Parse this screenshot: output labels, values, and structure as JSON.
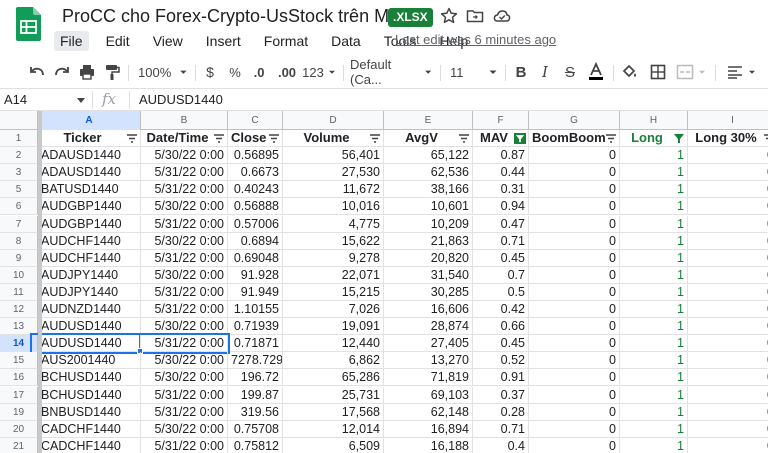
{
  "app": {
    "title": "ProCC cho Forex-Crypto-UsStock trên MT4",
    "badge": ".XLSX",
    "last_edit": "Last edit was 6 minutes ago",
    "brand_color": "#188038",
    "accent_color": "#1a73e8"
  },
  "menu": [
    "File",
    "Edit",
    "View",
    "Insert",
    "Format",
    "Data",
    "Tools",
    "Help"
  ],
  "toolbar": {
    "zoom": "100%",
    "currency": "$",
    "percent": "%",
    "dec_decrease": ".0",
    "dec_increase": ".00",
    "more_formats": "123",
    "font_family": "Default (Ca...",
    "font_size": "11",
    "icons": [
      "undo-icon",
      "redo-icon",
      "print-icon",
      "paint-format-icon",
      "bold-icon",
      "italic-icon",
      "strikethrough-icon",
      "text-color-icon",
      "fill-color-icon",
      "borders-icon",
      "merge-icon",
      "align-icon"
    ]
  },
  "formula_bar": {
    "cell_ref": "A14",
    "fx": "fx",
    "value": "AUDUSD1440"
  },
  "sheet": {
    "columns": [
      "A",
      "B",
      "C",
      "D",
      "E",
      "F",
      "G",
      "H",
      "I"
    ],
    "headers": [
      "Ticker",
      "Date/Time",
      "Close",
      "Volume",
      "AvgV",
      "MAV",
      "BoomBoom",
      "Long",
      "Long 30%"
    ],
    "selected_cell": "A14",
    "rows": [
      {
        "n": "1"
      },
      {
        "n": "2",
        "cells": [
          "ADAUSD1440",
          "5/30/22 0:00",
          "0.56895",
          "56,401",
          "65,122",
          "0.87",
          "0",
          "1",
          "0"
        ]
      },
      {
        "n": "3",
        "cells": [
          "ADAUSD1440",
          "5/31/22 0:00",
          "0.6673",
          "27,530",
          "62,536",
          "0.44",
          "0",
          "1",
          "0"
        ]
      },
      {
        "n": "5",
        "cells": [
          "BATUSD1440",
          "5/31/22 0:00",
          "0.40243",
          "11,672",
          "38,166",
          "0.31",
          "0",
          "1",
          "0"
        ]
      },
      {
        "n": "6",
        "cells": [
          "AUDGBP1440",
          "5/30/22 0:00",
          "0.56888",
          "10,016",
          "10,601",
          "0.94",
          "0",
          "1",
          "0"
        ]
      },
      {
        "n": "7",
        "cells": [
          "AUDGBP1440",
          "5/31/22 0:00",
          "0.57006",
          "4,775",
          "10,209",
          "0.47",
          "0",
          "1",
          "0"
        ]
      },
      {
        "n": "8",
        "cells": [
          "AUDCHF1440",
          "5/30/22 0:00",
          "0.6894",
          "15,622",
          "21,863",
          "0.71",
          "0",
          "1",
          "0"
        ]
      },
      {
        "n": "9",
        "cells": [
          "AUDCHF1440",
          "5/31/22 0:00",
          "0.69048",
          "9,278",
          "20,820",
          "0.45",
          "0",
          "1",
          "0"
        ]
      },
      {
        "n": "10",
        "cells": [
          "AUDJPY1440",
          "5/30/22 0:00",
          "91.928",
          "22,071",
          "31,540",
          "0.7",
          "0",
          "1",
          "0"
        ]
      },
      {
        "n": "11",
        "cells": [
          "AUDJPY1440",
          "5/31/22 0:00",
          "91.949",
          "15,215",
          "30,285",
          "0.5",
          "0",
          "1",
          "0"
        ]
      },
      {
        "n": "12",
        "cells": [
          "AUDNZD1440",
          "5/31/22 0:00",
          "1.10155",
          "7,026",
          "16,606",
          "0.42",
          "0",
          "1",
          "0"
        ]
      },
      {
        "n": "13",
        "cells": [
          "AUDUSD1440",
          "5/30/22 0:00",
          "0.71939",
          "19,091",
          "28,874",
          "0.66",
          "0",
          "1",
          "0"
        ]
      },
      {
        "n": "14",
        "cells": [
          "AUDUSD1440",
          "5/31/22 0:00",
          "0.71871",
          "12,440",
          "27,405",
          "0.45",
          "0",
          "1",
          "0"
        ]
      },
      {
        "n": "15",
        "cells": [
          "AUS2001440",
          "5/30/22 0:00",
          "7278.7299",
          "6,862",
          "13,270",
          "0.52",
          "0",
          "1",
          "0"
        ]
      },
      {
        "n": "16",
        "cells": [
          "BCHUSD1440",
          "5/30/22 0:00",
          "196.72",
          "65,286",
          "71,819",
          "0.91",
          "0",
          "1",
          "0"
        ]
      },
      {
        "n": "17",
        "cells": [
          "BCHUSD1440",
          "5/31/22 0:00",
          "199.87",
          "25,731",
          "69,103",
          "0.37",
          "0",
          "1",
          "0"
        ]
      },
      {
        "n": "19",
        "cells": [
          "BNBUSD1440",
          "5/31/22 0:00",
          "319.56",
          "17,568",
          "62,148",
          "0.28",
          "0",
          "1",
          "0"
        ]
      },
      {
        "n": "20",
        "cells": [
          "CADCHF1440",
          "5/30/22 0:00",
          "0.75708",
          "12,014",
          "16,894",
          "0.71",
          "0",
          "1",
          "0"
        ]
      },
      {
        "n": "21",
        "cells": [
          "CADCHF1440",
          "5/31/22 0:00",
          "0.75812",
          "6,509",
          "16,188",
          "0.4",
          "0",
          "1",
          "0"
        ]
      }
    ]
  }
}
